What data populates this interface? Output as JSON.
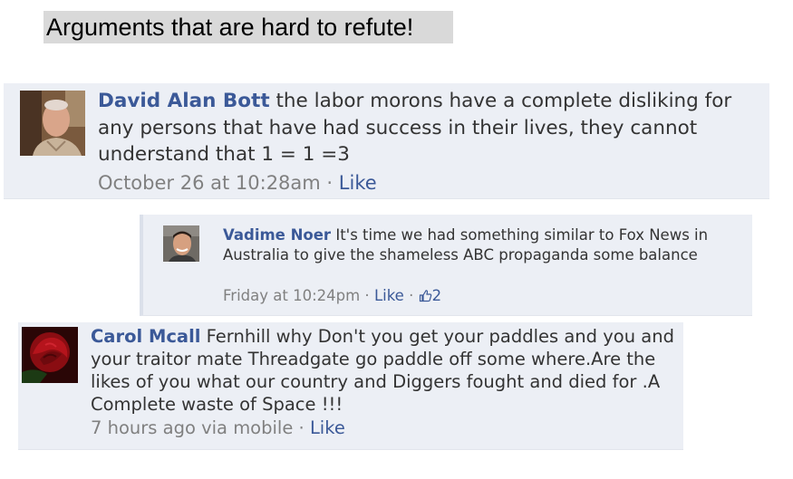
{
  "page_title": "Arguments that are hard to refute!",
  "comments": [
    {
      "author": "David Alan Bott",
      "text": " the labor morons have a complete disliking for any persons that have had success in their lives, they cannot understand that 1 = 1 =3",
      "time": "October 26 at 10:28am",
      "separator": " · ",
      "like": "Like",
      "avatar_icon": "profile-photo-man-elderly"
    },
    {
      "author": "Vadime Noer",
      "text": " It's time we had something similar to Fox News in Australia to give the shameless ABC propaganda some balance",
      "time": "Friday at 10:24pm",
      "separator": " · ",
      "like": "Like",
      "separator2": " · ",
      "like_count": "2",
      "avatar_icon": "profile-photo-young-man"
    },
    {
      "author": "Carol Mcall",
      "text": " Fernhill why Don't you get your paddles and you and your traitor mate Threadgate go paddle off some where.Are the likes of you what our country and Diggers fought and died for .A Complete waste of Space !!!",
      "time": "7 hours ago via mobile",
      "separator": " · ",
      "like": "Like",
      "avatar_icon": "profile-photo-red-rose"
    }
  ],
  "colors": {
    "author_link": "#3b5998",
    "comment_bg": "#eceff5",
    "meta_text": "#808080"
  }
}
